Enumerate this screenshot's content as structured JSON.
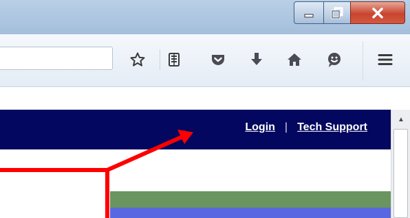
{
  "window": {
    "buttons": [
      "minimize",
      "maximize",
      "close"
    ]
  },
  "toolbar": {
    "url_value": "",
    "icons": [
      "star-icon",
      "reading-list-icon",
      "pocket-icon",
      "download-icon",
      "home-icon",
      "smiley-icon",
      "menu-icon"
    ]
  },
  "header": {
    "links": {
      "login": "Login",
      "separator": "|",
      "support": "Tech Support"
    }
  },
  "colors": {
    "navbar": "#03075f",
    "green_band": "#6a9460",
    "blue_band": "#5967e0",
    "annotation_arrow": "#ff0000"
  }
}
